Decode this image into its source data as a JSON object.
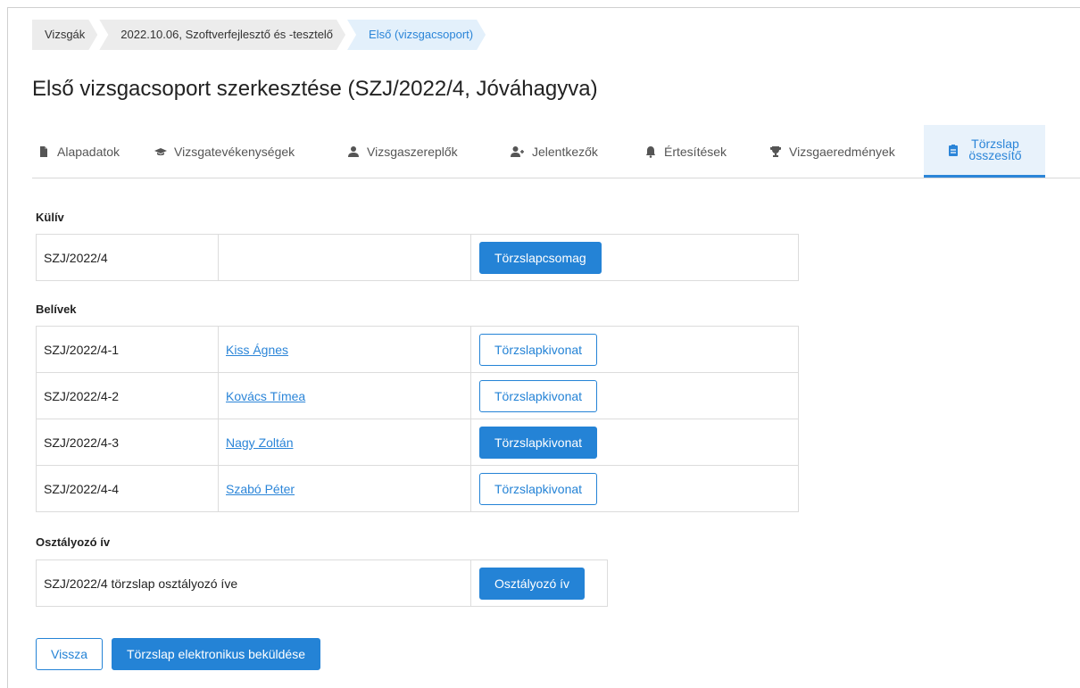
{
  "breadcrumb": [
    {
      "label": "Vizsgák"
    },
    {
      "label": "2022.10.06, Szoftverfejlesztő és -tesztelő"
    },
    {
      "label": "Első (vizsgacsoport)"
    }
  ],
  "page_title": "Első vizsgacsoport szerkesztése (SZJ/2022/4, Jóváhagyva)",
  "tabs": [
    {
      "label": "Alapadatok",
      "icon": "document-icon"
    },
    {
      "label": "Vizsgatevékenységek",
      "icon": "graduation-cap-icon"
    },
    {
      "label": "Vizsgaszereplők",
      "icon": "person-icon"
    },
    {
      "label": "Jelentkezők",
      "icon": "user-plus-icon"
    },
    {
      "label": "Értesítések",
      "icon": "bell-icon"
    },
    {
      "label": "Vizsgaeredmények",
      "icon": "trophy-icon"
    },
    {
      "label_line1": "Törzslap",
      "label_line2": "összesítő",
      "icon": "clipboard-icon",
      "active": true
    }
  ],
  "kuliv": {
    "heading": "Külív",
    "row": {
      "code": "SZJ/2022/4",
      "name": "",
      "button": "Törzslapcsomag"
    }
  },
  "belivek": {
    "heading": "Belívek",
    "rows": [
      {
        "code": "SZJ/2022/4-1",
        "name": "Kiss Ágnes",
        "button": "Törzslapkivonat",
        "style": "outline"
      },
      {
        "code": "SZJ/2022/4-2",
        "name": "Kovács Tímea",
        "button": "Törzslapkivonat",
        "style": "outline"
      },
      {
        "code": "SZJ/2022/4-3",
        "name": "Nagy Zoltán",
        "button": "Törzslapkivonat",
        "style": "primary"
      },
      {
        "code": "SZJ/2022/4-4",
        "name": "Szabó Péter",
        "button": "Törzslapkivonat",
        "style": "outline"
      }
    ]
  },
  "osztalyozo": {
    "heading": "Osztályozó ív",
    "row": {
      "label": "SZJ/2022/4 törzslap osztályozó íve",
      "button": "Osztályozó ív"
    }
  },
  "footer": {
    "back": "Vissza",
    "submit": "Törzslap elektronikus beküldése"
  },
  "colors": {
    "accent": "#2483d6",
    "active_tab_bg": "#e8f2fb",
    "crumb_bg": "#ececec"
  }
}
